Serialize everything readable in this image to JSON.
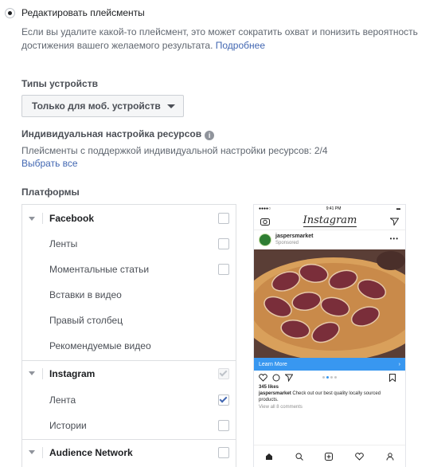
{
  "placement": {
    "option_label": "Редактировать плейсменты",
    "description": "Если вы удалите какой-то плейсмент, это может сократить охват и понизить вероятность достижения вашего желаемого результата.",
    "more_link": "Подробнее"
  },
  "device_types": {
    "title": "Типы устройств",
    "selected": "Только для моб. устройств"
  },
  "asset_customization": {
    "title": "Индивидуальная настройка ресурсов",
    "supported_text": "Плейсменты с поддержкой индивидуальной настройки ресурсов: 2/4",
    "select_all": "Выбрать все"
  },
  "platforms": {
    "title": "Платформы",
    "facebook": {
      "label": "Facebook",
      "checked": false,
      "items": [
        {
          "label": "Ленты",
          "checked": false,
          "checkbox": true
        },
        {
          "label": "Моментальные статьи",
          "checked": false,
          "checkbox": true
        },
        {
          "label": "Вставки в видео",
          "checkbox": false
        },
        {
          "label": "Правый столбец",
          "checkbox": false
        },
        {
          "label": "Рекомендуемые видео",
          "checkbox": false
        }
      ]
    },
    "instagram": {
      "label": "Instagram",
      "checked": true,
      "disabled": true,
      "items": [
        {
          "label": "Лента",
          "checked": true,
          "checkbox": true
        },
        {
          "label": "Истории",
          "checked": false,
          "checkbox": true
        }
      ]
    },
    "audience_network": {
      "label": "Audience Network",
      "checked": false
    }
  },
  "preview": {
    "time": "9:41 PM",
    "app_logo": "Instagram",
    "username": "jaspersmarket",
    "sponsored": "Sponsored",
    "cta": "Learn More",
    "likes": "345 likes",
    "caption_user": "jaspersmarket",
    "caption_text": "Check out our best quality locally sourced products.",
    "comments": "View all 8 comments",
    "cta_color": "#3897f0"
  }
}
